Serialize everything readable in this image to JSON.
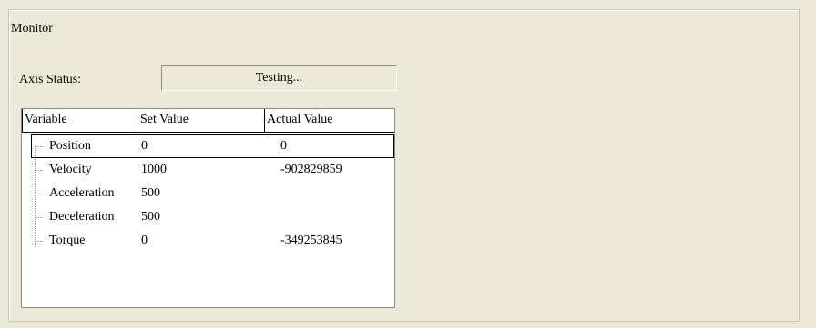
{
  "monitor": {
    "title": "Monitor",
    "axis_status_label": "Axis Status:",
    "axis_status_value": "Testing..."
  },
  "table": {
    "headers": [
      "Variable",
      "Set Value",
      "Actual Value"
    ],
    "rows": [
      {
        "variable": "Position",
        "set_value": "0",
        "actual_value": "0",
        "selected": true
      },
      {
        "variable": "Velocity",
        "set_value": "1000",
        "actual_value": "-902829859"
      },
      {
        "variable": "Acceleration",
        "set_value": "500",
        "actual_value": ""
      },
      {
        "variable": "Deceleration",
        "set_value": "500",
        "actual_value": ""
      },
      {
        "variable": "Torque",
        "set_value": "0",
        "actual_value": "-349253845"
      }
    ]
  }
}
